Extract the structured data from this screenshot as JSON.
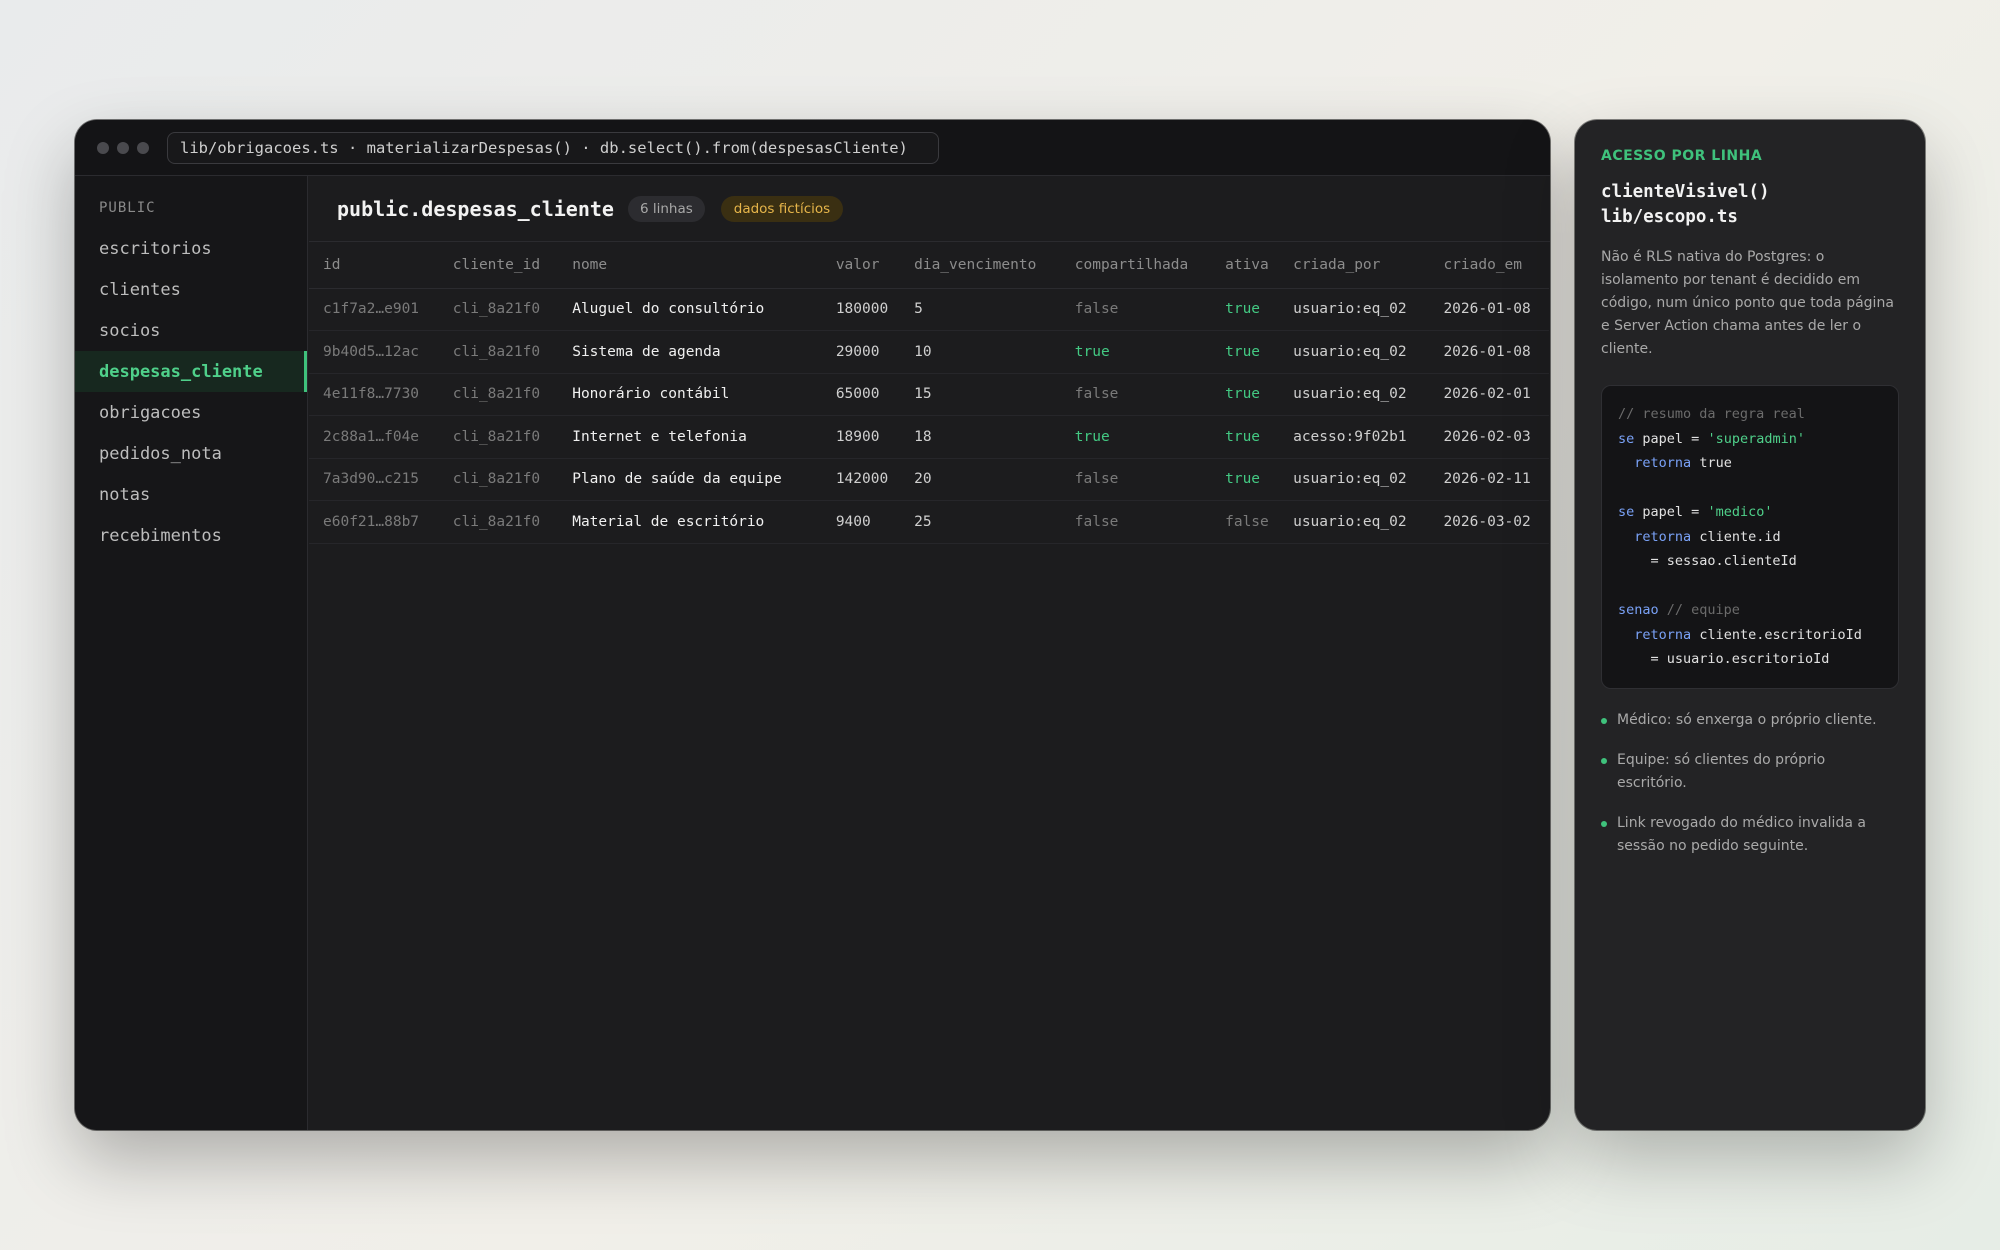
{
  "window": {
    "path": "lib/obrigacoes.ts · materializarDespesas() · db.select().from(despesasCliente)"
  },
  "sidebar": {
    "header": "PUBLIC",
    "items": [
      {
        "label": "escritorios"
      },
      {
        "label": "clientes"
      },
      {
        "label": "socios"
      },
      {
        "label": "despesas_cliente",
        "active": true
      },
      {
        "label": "obrigacoes"
      },
      {
        "label": "pedidos_nota"
      },
      {
        "label": "notas"
      },
      {
        "label": "recebimentos"
      }
    ]
  },
  "table": {
    "title": "public.despesas_cliente",
    "row_count": "6 linhas",
    "badge": "dados fictícios",
    "columns": [
      "id",
      "cliente_id",
      "nome",
      "valor",
      "dia_vencimento",
      "compartilhada",
      "ativa",
      "criada_por",
      "criado_em"
    ],
    "rows": [
      [
        "c1f7a2…e901",
        "cli_8a21f0",
        "Aluguel do consultório",
        "180000",
        "5",
        "false",
        "true",
        "usuario:eq_02",
        "2026-01-08"
      ],
      [
        "9b40d5…12ac",
        "cli_8a21f0",
        "Sistema de agenda",
        "29000",
        "10",
        "true",
        "true",
        "usuario:eq_02",
        "2026-01-08"
      ],
      [
        "4e11f8…7730",
        "cli_8a21f0",
        "Honorário contábil",
        "65000",
        "15",
        "false",
        "true",
        "usuario:eq_02",
        "2026-02-01"
      ],
      [
        "2c88a1…f04e",
        "cli_8a21f0",
        "Internet e telefonia",
        "18900",
        "18",
        "true",
        "true",
        "acesso:9f02b1",
        "2026-02-03"
      ],
      [
        "7a3d90…c215",
        "cli_8a21f0",
        "Plano de saúde da equipe",
        "142000",
        "20",
        "false",
        "true",
        "usuario:eq_02",
        "2026-02-11"
      ],
      [
        "e60f21…88b7",
        "cli_8a21f0",
        "Material de escritório",
        "9400",
        "25",
        "false",
        "false",
        "usuario:eq_02",
        "2026-03-02"
      ]
    ]
  },
  "panel": {
    "kicker": "ACESSO POR LINHA",
    "title_line1": "clienteVisivel()",
    "title_line2": "lib/escopo.ts",
    "description": "Não é RLS nativa do Postgres: o isolamento por tenant é decidido em código, num único ponto que toda página e Server Action chama antes de ler o cliente.",
    "code": {
      "comment": "// resumo da regra real",
      "kw_se": "se",
      "kw_retorna": "retorna",
      "kw_senao": "senao",
      "papel_eq": "papel =",
      "str_superadmin": "'superadmin'",
      "str_medico": "'medico'",
      "val_true": "true",
      "expr_cliente_id": "cliente.id",
      "expr_sessao": "= sessao.clienteId",
      "comment_equipe": "// equipe",
      "expr_escritorio": "cliente.escritorioId",
      "expr_usuario": "= usuario.escritorioId"
    },
    "bullets": [
      "Médico: só enxerga o próprio cliente.",
      "Equipe: só clientes do próprio escritório.",
      "Link revogado do médico invalida a sessão no pedido seguinte."
    ]
  }
}
